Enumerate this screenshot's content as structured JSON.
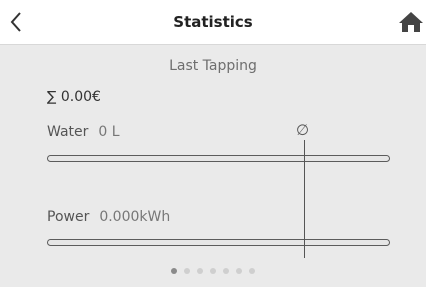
{
  "header": {
    "title": "Statistics"
  },
  "main": {
    "subtitle": "Last Tapping",
    "total": "∑ 0.00€",
    "water": {
      "label": "Water",
      "value": "0 L",
      "fill": 0
    },
    "power": {
      "label": "Power",
      "value": "0.000kWh",
      "fill": 0
    },
    "average_symbol": "∅"
  },
  "pagination": {
    "count": 7,
    "active": 0
  },
  "icons": {
    "back": "chevron-left-icon",
    "home": "home-icon"
  },
  "colors": {
    "background": "#eaeaea",
    "header": "#ffffff",
    "bar_border": "#5c5c5c"
  }
}
